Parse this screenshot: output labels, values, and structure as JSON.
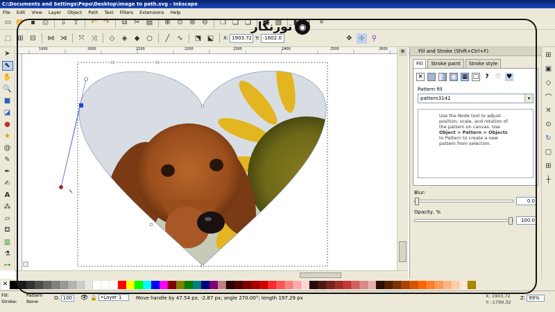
{
  "window": {
    "title": "C:\\Documents and Settings\\Pepo\\Desktop\\image to path.svg - Inkscape"
  },
  "menu": [
    "File",
    "Edit",
    "View",
    "Layer",
    "Object",
    "Path",
    "Text",
    "Filters",
    "Extensions",
    "Help"
  ],
  "toolbar2": {
    "x_label": "X:",
    "x_value": "1903.72",
    "y_label": "Y:",
    "y_value": "-1602.0"
  },
  "ruler_ticks": [
    "1900",
    "2000",
    "2100",
    "2200",
    "2300",
    "2400",
    "2500",
    "2600"
  ],
  "logo_text": "نورنگار",
  "dock": {
    "title": "Fill and Stroke (Shift+Ctrl+F)",
    "tabs": [
      "Fill",
      "Stroke paint",
      "Stroke style"
    ],
    "section_label": "Pattern fill",
    "select_value": "pattern3141",
    "help_lines": [
      "Use the Node tool to adjust",
      "position, scale, and rotation of",
      "the pattern on canvas. Use",
      "Object > Pattern > Objects",
      "to Pattern to create a new",
      "pattern from selection."
    ],
    "blur_label": "Blur:",
    "blur_value": "0.0",
    "opacity_label": "Opacity, %",
    "opacity_value": "100.0"
  },
  "status": {
    "fill_label": "Fill:",
    "fill_value": "Pattern",
    "stroke_label": "Stroke:",
    "stroke_value": "None",
    "o_label": "O:",
    "o_value": "100",
    "layer": "•Layer 1",
    "message": "Move handle by 47.54 px, -2.87 px; angle 270.00°; length 197.29 px",
    "x_readout": "X: 1903.72",
    "y_readout": "Y: -1799.32",
    "zoom_label": "Z:",
    "zoom_value": "99%"
  },
  "palette": [
    "#000000",
    "#1a1a1a",
    "#333333",
    "#4d4d4d",
    "#666666",
    "#808080",
    "#999999",
    "#b3b3b3",
    "#cccccc",
    "#e6e6e6",
    "#ffffff",
    "#ffffff",
    "#ffffff",
    "#ff0000",
    "#ffff00",
    "#00ff00",
    "#00ffff",
    "#0000ff",
    "#ff00ff",
    "#800000",
    "#808000",
    "#008000",
    "#008080",
    "#000080",
    "#800080",
    "#c08080",
    "#2a0000",
    "#550000",
    "#800000",
    "#aa0000",
    "#d40000",
    "#ff2a2a",
    "#ff5555",
    "#ff8080",
    "#ffaaaa",
    "#ffd5d5",
    "#280b0b",
    "#501616",
    "#782121",
    "#a02c2c",
    "#c83737",
    "#d35f5f",
    "#de8787",
    "#e9afaf",
    "#2b1100",
    "#552200",
    "#803300",
    "#aa4400",
    "#d45500",
    "#ff6600",
    "#ff7f2a",
    "#ff9955",
    "#ffb380",
    "#ffccaa",
    "#ffe6d5",
    "#aa8800"
  ]
}
